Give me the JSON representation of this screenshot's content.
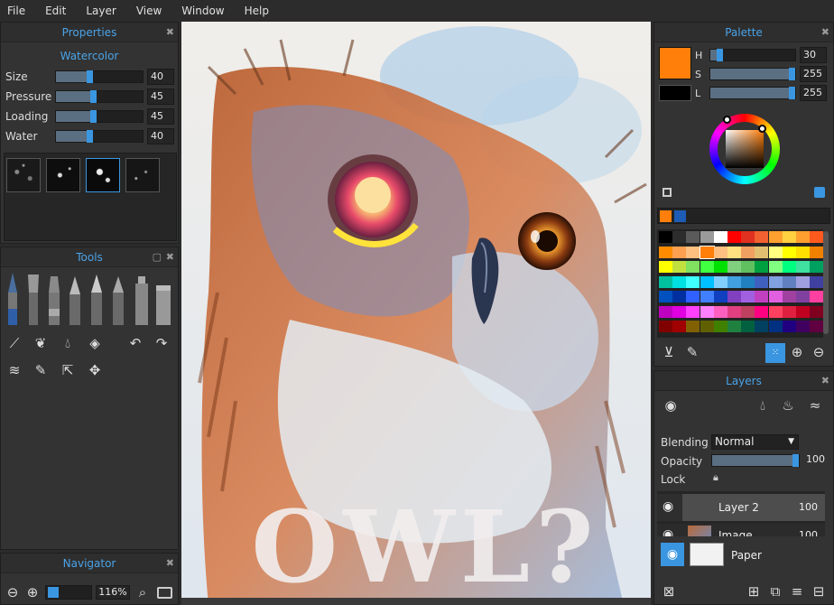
{
  "menu": [
    "File",
    "Edit",
    "Layer",
    "View",
    "Window",
    "Help"
  ],
  "properties": {
    "title": "Properties",
    "brush_name": "Watercolor",
    "sliders": [
      {
        "label": "Size",
        "value": "40",
        "level": 0.4
      },
      {
        "label": "Pressure",
        "value": "45",
        "level": 0.45
      },
      {
        "label": "Loading",
        "value": "45",
        "level": 0.45
      },
      {
        "label": "Water",
        "value": "40",
        "level": 0.4
      }
    ]
  },
  "tools": {
    "title": "Tools"
  },
  "navigator": {
    "title": "Navigator",
    "zoom": "116%"
  },
  "palette": {
    "title": "Palette",
    "primary_color": "#ff7f0a",
    "secondary_color": "#000000",
    "hsl": [
      {
        "label": "H",
        "value": "30",
        "level": 0.12
      },
      {
        "label": "S",
        "value": "255",
        "level": 1.0
      },
      {
        "label": "L",
        "value": "255",
        "level": 1.0
      }
    ],
    "recent_colors": [
      "#ff7f0a",
      "#1e5bb5"
    ],
    "swatches": [
      "#000000",
      "#2d2d2d",
      "#5a5a5a",
      "#9a9a9a",
      "#ffffff",
      "#ff0000",
      "#e03020",
      "#f06030",
      "#ffa030",
      "#ffd040",
      "#ff9f30",
      "#ff5a1e",
      "#ff8c00",
      "#ff9f50",
      "#ffc080",
      "#ff7f0a",
      "#ffbf80",
      "#ffe080",
      "#f0a060",
      "#e0c070",
      "#ffff80",
      "#ffff00",
      "#ffe000",
      "#f08000",
      "#ffff00",
      "#c0e040",
      "#80e060",
      "#40ff40",
      "#00e000",
      "#80d080",
      "#60c060",
      "#00a040",
      "#80ff80",
      "#00ff80",
      "#40e0a0",
      "#00a060",
      "#00c0a0",
      "#00e0e0",
      "#40ffff",
      "#00c0ff",
      "#80d0ff",
      "#40a0e0",
      "#2080c0",
      "#4060c0",
      "#80a0e0",
      "#6080c0",
      "#a0a0e0",
      "#4040a0",
      "#0050c0",
      "#0030a0",
      "#3060ff",
      "#4080ff",
      "#1040c0",
      "#8040c0",
      "#a060e0",
      "#c040c0",
      "#e060e0",
      "#a040a0",
      "#8040a0",
      "#ff40a0",
      "#c000c0",
      "#e000e0",
      "#ff40ff",
      "#ff80ff",
      "#ff60c0",
      "#e04080",
      "#c04060",
      "#ff0080",
      "#ff4060",
      "#e02040",
      "#c00020",
      "#800020",
      "#800000",
      "#a00000",
      "#806000",
      "#606000",
      "#408000",
      "#208040",
      "#006040",
      "#004060",
      "#003080",
      "#200080",
      "#400060",
      "#600040"
    ]
  },
  "layers": {
    "title": "Layers",
    "blending_label": "Blending",
    "blending_value": "Normal",
    "opacity_label": "Opacity",
    "opacity_value": "100",
    "opacity_level": 1.0,
    "lock_label": "Lock",
    "items": [
      {
        "name": "Layer 2",
        "opacity": "100"
      },
      {
        "name": "Image",
        "opacity": "100"
      }
    ],
    "paper_label": "Paper"
  },
  "canvas": {
    "title_text": "OWL?"
  }
}
